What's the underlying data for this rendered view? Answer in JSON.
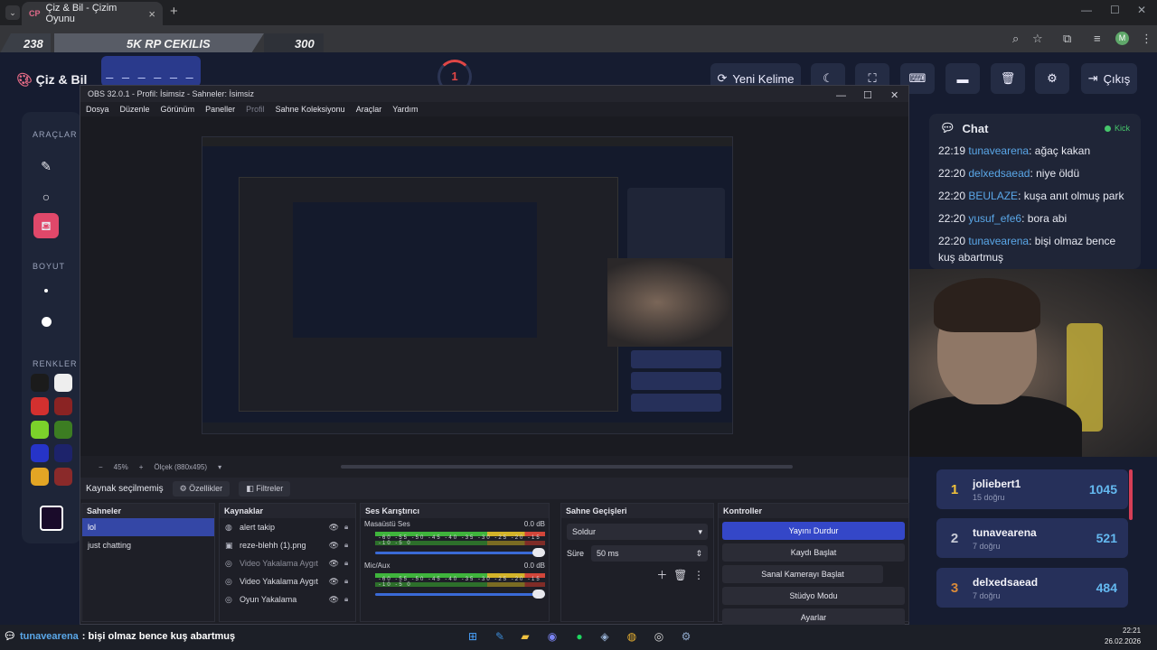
{
  "browser": {
    "tab_title": "Çiz & Bil - Çizim Oyunu",
    "tab_favicon": "CP",
    "avatar_letter": "M"
  },
  "banner": {
    "left_number": "238",
    "center_text": "5K RP CEKILIS",
    "right_number": "300"
  },
  "app": {
    "logo_text": "Çiz & Bil",
    "word_hint": "_ _ _ _ _ _ _",
    "timer_value": "1",
    "new_word_label": "Yeni Kelime",
    "exit_label": "Çıkış",
    "tools": {
      "tools_label": "ARAÇLAR",
      "size_label": "BOYUT",
      "colors_label": "RENKLER"
    },
    "colors": [
      "#1b1b1b",
      "#eeeeee",
      "#d3302f",
      "#8a2323",
      "#7bd12b",
      "#3c7d22",
      "#2634c8",
      "#1d236b",
      "#e3a524",
      "#8a2a2a"
    ]
  },
  "chat": {
    "title": "Chat",
    "platform": "Kick",
    "messages": [
      {
        "time": "22:19",
        "user": "tunavearena",
        "text": "ağaç kakan"
      },
      {
        "time": "22:20",
        "user": "delxedsaead",
        "text": "niye öldü"
      },
      {
        "time": "22:20",
        "user": "BEULAZE",
        "text": "kuşa anıt olmuş park"
      },
      {
        "time": "22:20",
        "user": "yusuf_efe6",
        "text": "bora abi"
      },
      {
        "time": "22:20",
        "user": "tunavearena",
        "text": "bişi olmaz bence kuş abartmuş"
      }
    ]
  },
  "leaderboard": [
    {
      "rank": "1",
      "name": "joliebert1",
      "sub": "15 doğru",
      "points": "1045",
      "rank_color": "#f2c23a"
    },
    {
      "rank": "2",
      "name": "tunavearena",
      "sub": "7 doğru",
      "points": "521",
      "rank_color": "#c8cbd6"
    },
    {
      "rank": "3",
      "name": "delxedsaead",
      "sub": "7 doğru",
      "points": "484",
      "rank_color": "#d98a3a"
    }
  ],
  "obs": {
    "title": "OBS 32.0.1 - Profil: İsimsiz - Sahneler: İsimsiz",
    "menu": [
      "Dosya",
      "Düzenle",
      "Görünüm",
      "Paneller",
      "Profil",
      "Sahne Koleksiyonu",
      "Araçlar",
      "Yardım"
    ],
    "zoom": "45%",
    "scale_text": "Ölçek (880x495)",
    "no_source": "Kaynak seçilmemiş",
    "properties_label": "Özellikler",
    "filters_label": "Filtreler",
    "scenes_title": "Sahneler",
    "scenes": [
      "lol",
      "just chatting"
    ],
    "sources_title": "Kaynaklar",
    "sources": [
      "alert takip",
      "reze-blehh (1).png",
      "Video Yakalama Aygıt",
      "Video Yakalama Aygıt",
      "Oyun Yakalama"
    ],
    "mixer_title": "Ses Karıştırıcı",
    "mixer": [
      {
        "name": "Masaüstü Ses",
        "db": "0.0 dB"
      },
      {
        "name": "Mic/Aux",
        "db": "0.0 dB"
      }
    ],
    "meter_scale": "-60 -55 -50 -45 -40 -35 -30 -25 -20 -15 -10 -5 0",
    "transitions_title": "Sahne Geçişleri",
    "transition": "Soldur",
    "duration_label": "Süre",
    "duration_value": "50 ms",
    "controls_title": "Kontroller",
    "controls": [
      "Yayını Durdur",
      "Kaydı Başlat",
      "Sanal Kamerayı Başlat",
      "Stüdyo Modu",
      "Ayarlar"
    ]
  },
  "ticker": {
    "user": "tunavearena",
    "text": ": bişi olmaz bence kuş abartmuş"
  },
  "taskbar": {
    "time": "22:21",
    "date": "26.02.2026"
  }
}
